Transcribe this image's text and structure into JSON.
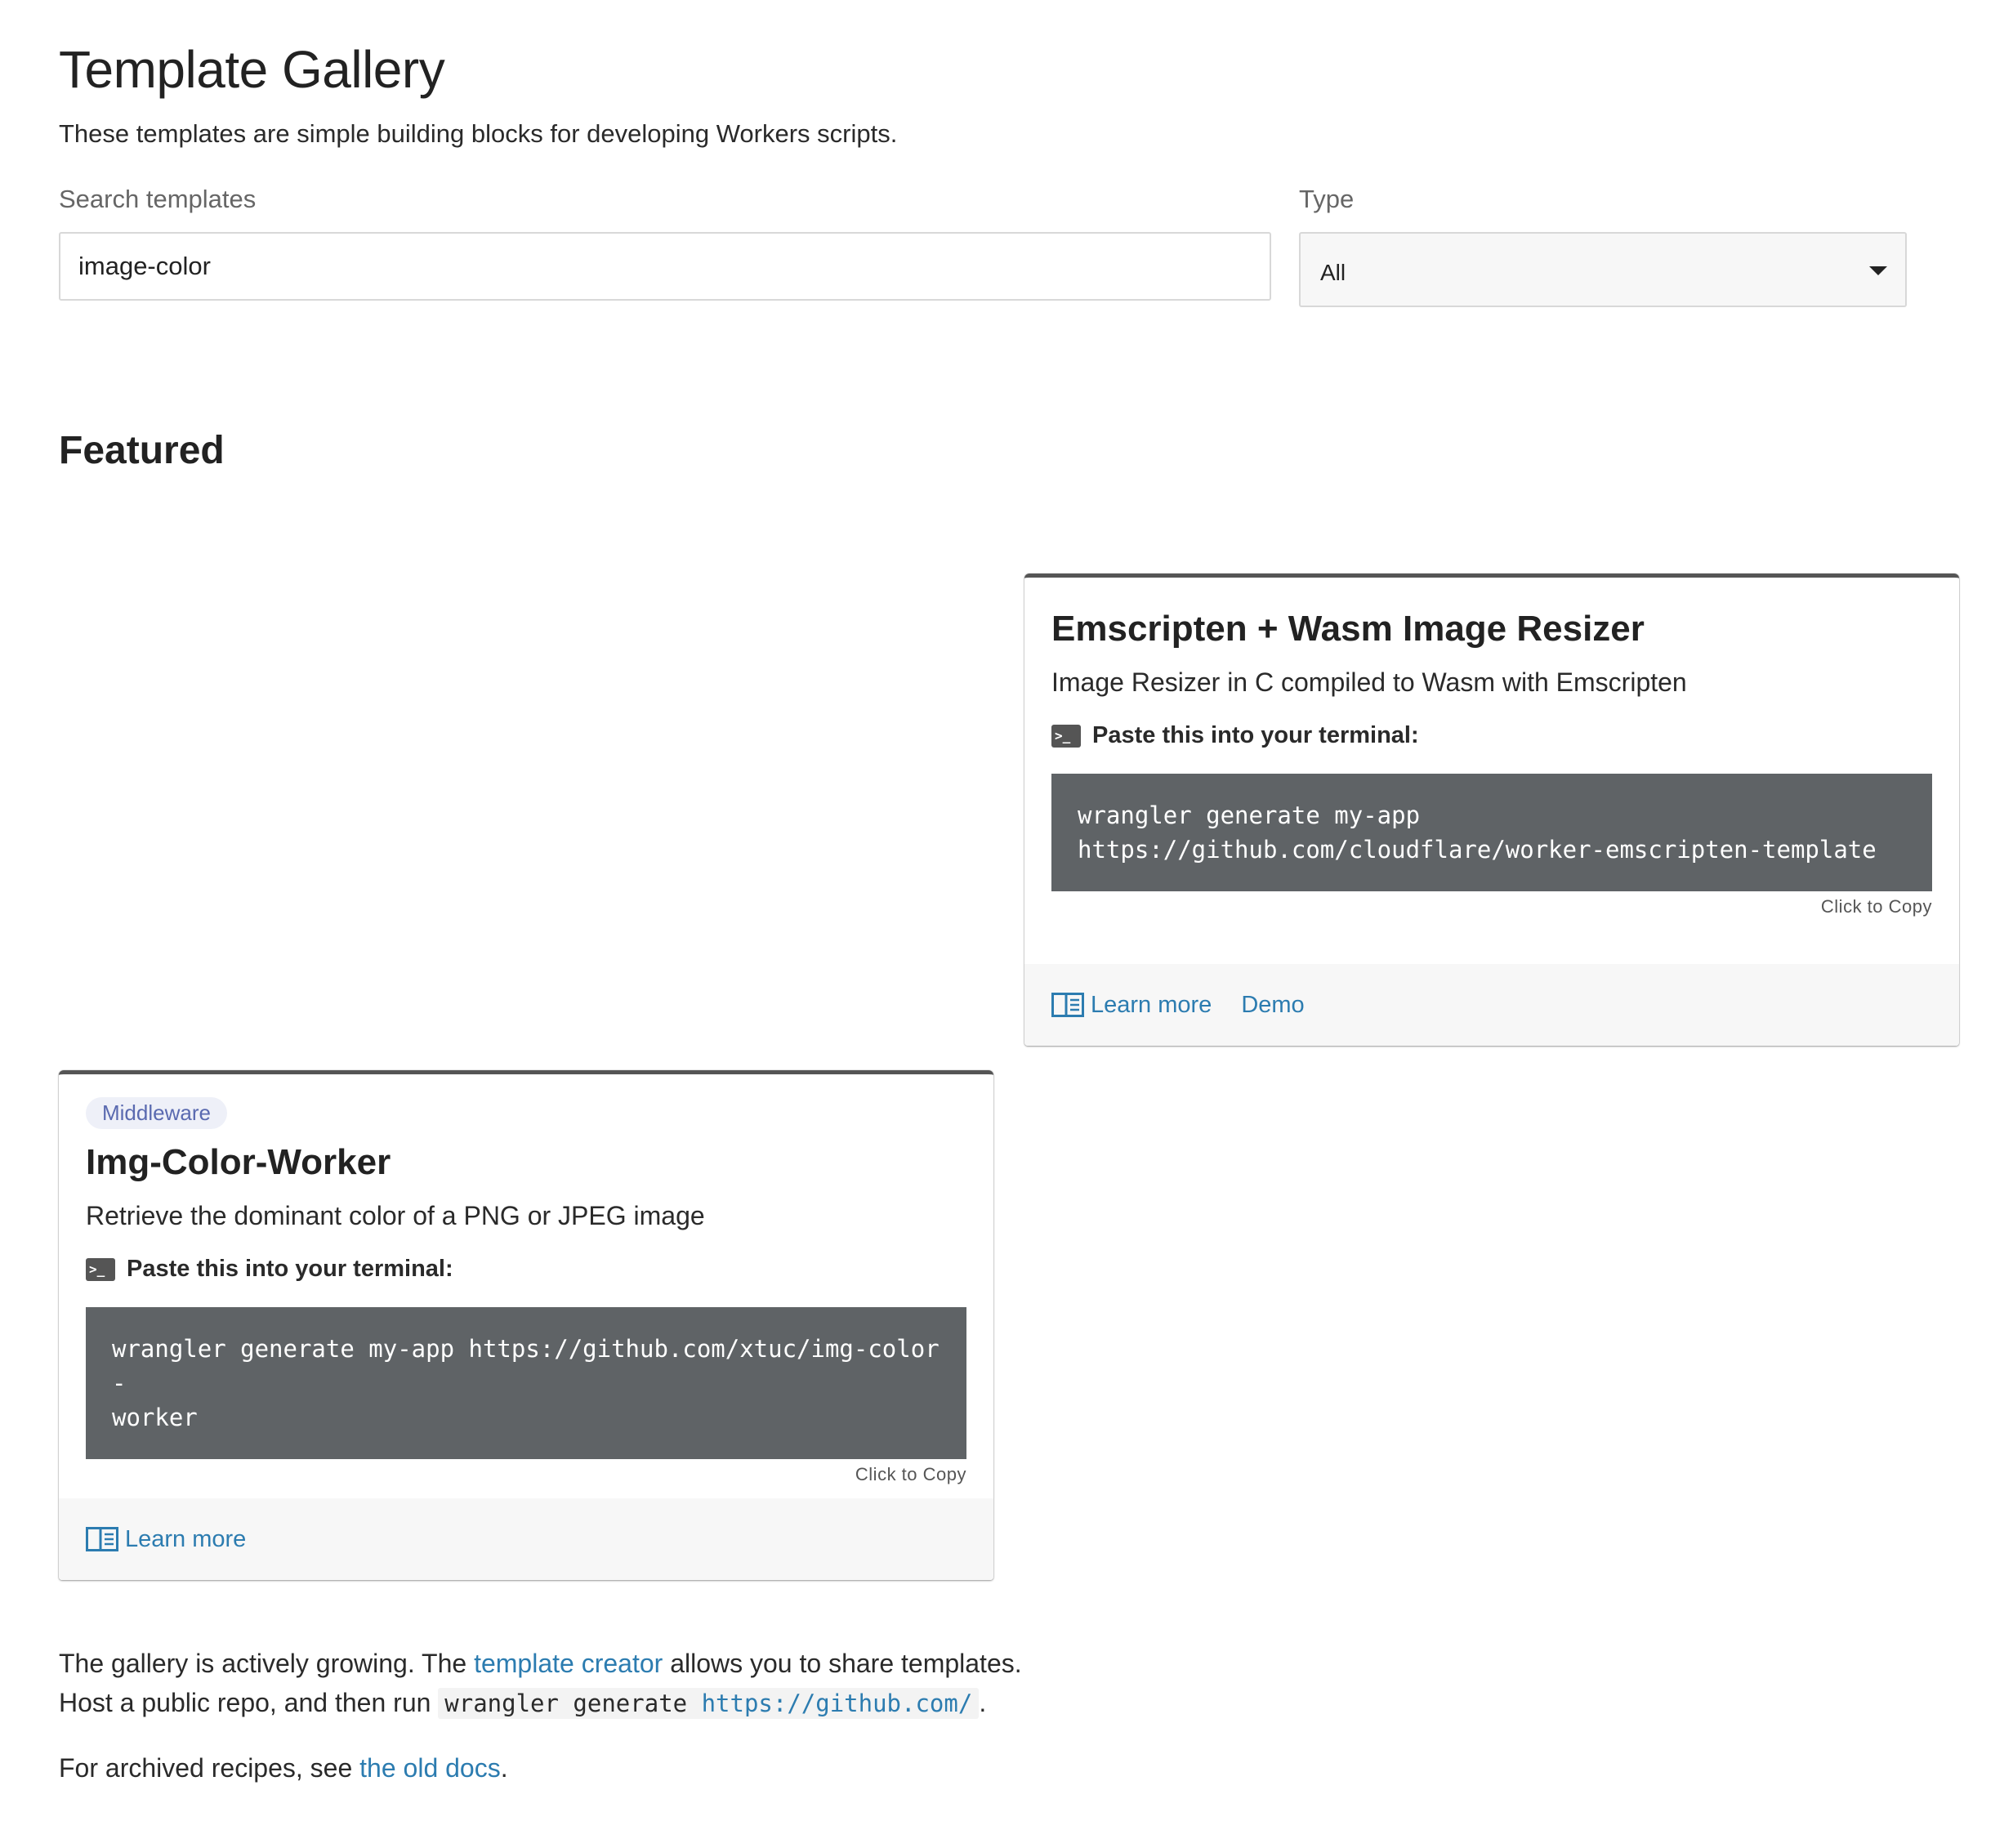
{
  "page": {
    "title": "Template Gallery",
    "subtitle": "These templates are simple building blocks for developing Workers scripts."
  },
  "search": {
    "label": "Search templates",
    "value": "image-color"
  },
  "type_filter": {
    "label": "Type",
    "selected": "All"
  },
  "featured": {
    "title": "Featured",
    "cards": [
      {
        "title": "Emscripten + Wasm Image Resizer",
        "description": "Image Resizer in C compiled to Wasm with Emscripten",
        "terminal_label": "Paste this into your terminal:",
        "command_line1": "wrangler generate my-app",
        "command_line2": "https://github.com/cloudflare/worker-emscripten-template",
        "copy_hint": "Click to Copy",
        "learn_more": "Learn more",
        "demo": "Demo"
      },
      {
        "badge": "Middleware",
        "title": "Img-Color-Worker",
        "description": "Retrieve the dominant color of a PNG or JPEG image",
        "terminal_label": "Paste this into your terminal:",
        "command_line1": "wrangler generate my-app https://github.com/xtuc/img-color-",
        "command_line2": "worker",
        "copy_hint": "Click to Copy",
        "learn_more": "Learn more"
      }
    ]
  },
  "footer": {
    "line1_before": "The gallery is actively growing. The ",
    "line1_link": "template creator",
    "line1_after": " allows you to share templates.",
    "line2_before": "Host a public repo, and then run ",
    "line2_code": "wrangler generate ",
    "line2_code_link": "https://github.com/",
    "line2_after": ".",
    "line3_before": "For archived recipes, see ",
    "line3_link": "the old docs",
    "line3_after": "."
  },
  "colors": {
    "link": "#2c7cb0",
    "code_background": "#5f6366",
    "card_top_border": "#555555",
    "badge_background": "#eef0f8",
    "badge_text": "#5a6ab0"
  },
  "icons": {
    "terminal": "terminal-icon",
    "learn_more": "book-icon",
    "select": "chevron-down-icon"
  }
}
